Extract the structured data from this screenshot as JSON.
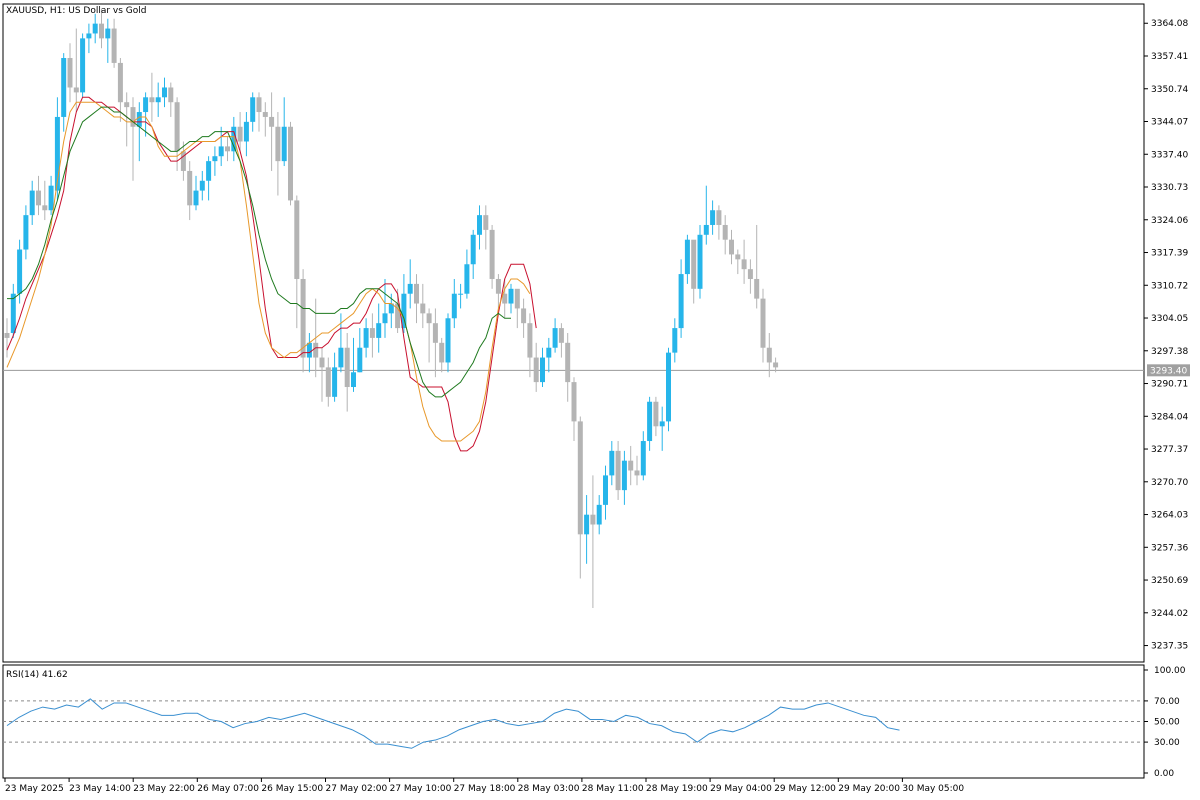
{
  "window": {
    "symbol_title": "XAUUSD, H1:  US Dollar vs Gold"
  },
  "colors": {
    "bull": "#26b5ea",
    "bear": "#b4b4b4",
    "ma_fast": "#c8102e",
    "ma_mid": "#e8982a",
    "ma_slow": "#1f7a1f",
    "rsi_line": "#3a8fd0",
    "current_price_line": "#9a9a9a",
    "price_tag_bg": "#a0a0a0"
  },
  "chart_data": [
    {
      "type": "candlestick",
      "title": "XAUUSD, H1:  US Dollar vs Gold",
      "ylim": [
        3234.0,
        3368.0
      ],
      "y_ticks": [
        "3364.08",
        "3357.41",
        "3350.74",
        "3344.07",
        "3337.40",
        "3330.73",
        "3324.06",
        "3317.39",
        "3310.72",
        "3304.05",
        "3297.38",
        "3290.71",
        "3284.04",
        "3277.37",
        "3270.70",
        "3264.03",
        "3257.36",
        "3250.69",
        "3244.02",
        "3237.35"
      ],
      "current_price": 3293.4,
      "current_price_label": "3293.40",
      "x_ticks": [
        "23 May 2025",
        "23 May 14:00",
        "23 May 22:00",
        "26 May 07:00",
        "26 May 15:00",
        "27 May 02:00",
        "27 May 10:00",
        "27 May 18:00",
        "28 May 03:00",
        "28 May 11:00",
        "28 May 19:00",
        "29 May 04:00",
        "29 May 12:00",
        "29 May 20:00",
        "30 May 05:00"
      ],
      "candles": [
        [
          3301,
          3300,
          3304,
          3296
        ],
        [
          3301,
          3309,
          3311,
          3300
        ],
        [
          3309,
          3318,
          3320,
          3307
        ],
        [
          3318,
          3325,
          3327,
          3316
        ],
        [
          3325,
          3330,
          3332,
          3323
        ],
        [
          3330,
          3327,
          3333,
          3325
        ],
        [
          3327,
          3326,
          3332,
          3324
        ],
        [
          3326,
          3331,
          3333,
          3325
        ],
        [
          3330,
          3345,
          3349,
          3328
        ],
        [
          3345,
          3357,
          3358,
          3342
        ],
        [
          3357,
          3351,
          3360,
          3348
        ],
        [
          3351,
          3350,
          3363,
          3346
        ],
        [
          3350,
          3361,
          3362,
          3349
        ],
        [
          3361,
          3362,
          3364,
          3358
        ],
        [
          3362,
          3364,
          3366,
          3360
        ],
        [
          3364,
          3361,
          3367,
          3359
        ],
        [
          3361,
          3363,
          3365,
          3356
        ],
        [
          3363,
          3356,
          3365,
          3355
        ],
        [
          3356,
          3348,
          3357,
          3344
        ],
        [
          3348,
          3347,
          3350,
          3339
        ],
        [
          3347,
          3343,
          3349,
          3332
        ],
        [
          3343,
          3346,
          3348,
          3336
        ],
        [
          3346,
          3349,
          3350,
          3341
        ],
        [
          3349,
          3348,
          3354,
          3344
        ],
        [
          3348,
          3349,
          3352,
          3345
        ],
        [
          3349,
          3351,
          3353,
          3347
        ],
        [
          3351,
          3348,
          3352,
          3345
        ],
        [
          3348,
          3338,
          3349,
          3334
        ],
        [
          3338,
          3334,
          3340,
          3332
        ],
        [
          3334,
          3327,
          3336,
          3324
        ],
        [
          3327,
          3330,
          3333,
          3326
        ],
        [
          3330,
          3332,
          3334,
          3328
        ],
        [
          3332,
          3336,
          3337,
          3328
        ],
        [
          3336,
          3337,
          3339,
          3333
        ],
        [
          3337,
          3339,
          3343,
          3335
        ],
        [
          3339,
          3338,
          3341,
          3336
        ],
        [
          3338,
          3343,
          3345,
          3336
        ],
        [
          3343,
          3340,
          3346,
          3338
        ],
        [
          3340,
          3344,
          3346,
          3337
        ],
        [
          3344,
          3349,
          3350,
          3342
        ],
        [
          3349,
          3346,
          3350,
          3342
        ],
        [
          3346,
          3345,
          3348,
          3341
        ],
        [
          3345,
          3343,
          3350,
          3334
        ],
        [
          3343,
          3336,
          3346,
          3329
        ],
        [
          3336,
          3343,
          3349,
          3335
        ],
        [
          3343,
          3328,
          3344,
          3327
        ],
        [
          3328,
          3312,
          3329,
          3302
        ],
        [
          3312,
          3296,
          3314,
          3293
        ],
        [
          3296,
          3299,
          3301,
          3293
        ],
        [
          3299,
          3296,
          3308,
          3292
        ],
        [
          3296,
          3294,
          3298,
          3287
        ],
        [
          3294,
          3288,
          3296,
          3286
        ],
        [
          3288,
          3294,
          3297,
          3287
        ],
        [
          3294,
          3298,
          3305,
          3293
        ],
        [
          3298,
          3290,
          3301,
          3285
        ],
        [
          3290,
          3293,
          3300,
          3289
        ],
        [
          3293,
          3298,
          3302,
          3293
        ],
        [
          3298,
          3302,
          3304,
          3296
        ],
        [
          3302,
          3300,
          3305,
          3296
        ],
        [
          3300,
          3303,
          3307,
          3297
        ],
        [
          3303,
          3305,
          3312,
          3300
        ],
        [
          3305,
          3307,
          3309,
          3302
        ],
        [
          3307,
          3302,
          3310,
          3301
        ],
        [
          3302,
          3309,
          3313,
          3301
        ],
        [
          3309,
          3311,
          3316,
          3306
        ],
        [
          3311,
          3307,
          3313,
          3303
        ],
        [
          3307,
          3305,
          3311,
          3302
        ],
        [
          3305,
          3303,
          3306,
          3295
        ],
        [
          3303,
          3299,
          3306,
          3292
        ],
        [
          3299,
          3295,
          3300,
          3293
        ],
        [
          3295,
          3304,
          3305,
          3293
        ],
        [
          3304,
          3309,
          3312,
          3302
        ],
        [
          3309,
          3309,
          3311,
          3306
        ],
        [
          3309,
          3315,
          3318,
          3308
        ],
        [
          3315,
          3321,
          3322,
          3312
        ],
        [
          3321,
          3325,
          3327,
          3318
        ],
        [
          3325,
          3322,
          3327,
          3318
        ],
        [
          3322,
          3312,
          3323,
          3310
        ],
        [
          3312,
          3309,
          3313,
          3306
        ],
        [
          3309,
          3307,
          3312,
          3304
        ],
        [
          3307,
          3310,
          3311,
          3305
        ],
        [
          3310,
          3306,
          3309,
          3302
        ],
        [
          3306,
          3303,
          3308,
          3300
        ],
        [
          3303,
          3296,
          3305,
          3292
        ],
        [
          3296,
          3291,
          3299,
          3289
        ],
        [
          3291,
          3296,
          3298,
          3290
        ],
        [
          3296,
          3298,
          3300,
          3293
        ],
        [
          3298,
          3302,
          3304,
          3297
        ],
        [
          3302,
          3299,
          3303,
          3296
        ],
        [
          3299,
          3291,
          3301,
          3287
        ],
        [
          3291,
          3283,
          3292,
          3279
        ],
        [
          3283,
          3260,
          3284,
          3251
        ],
        [
          3260,
          3264,
          3268,
          3254
        ],
        [
          3264,
          3262,
          3272,
          3245
        ],
        [
          3262,
          3266,
          3268,
          3260
        ],
        [
          3266,
          3272,
          3274,
          3263
        ],
        [
          3272,
          3277,
          3279,
          3270
        ],
        [
          3277,
          3269,
          3279,
          3267
        ],
        [
          3269,
          3275,
          3277,
          3266
        ],
        [
          3275,
          3273,
          3278,
          3270
        ],
        [
          3273,
          3272,
          3276,
          3270
        ],
        [
          3272,
          3279,
          3281,
          3271
        ],
        [
          3279,
          3287,
          3288,
          3277
        ],
        [
          3287,
          3282,
          3288,
          3280
        ],
        [
          3282,
          3283,
          3286,
          3277
        ],
        [
          3283,
          3297,
          3298,
          3281
        ],
        [
          3297,
          3302,
          3304,
          3295
        ],
        [
          3302,
          3313,
          3316,
          3300
        ],
        [
          3313,
          3320,
          3321,
          3311
        ],
        [
          3320,
          3310,
          3319,
          3307
        ],
        [
          3310,
          3321,
          3323,
          3308
        ],
        [
          3321,
          3323,
          3331,
          3319
        ],
        [
          3323,
          3326,
          3328,
          3321
        ],
        [
          3326,
          3323,
          3327,
          3320
        ],
        [
          3323,
          3320,
          3325,
          3317
        ],
        [
          3320,
          3317,
          3322,
          3315
        ],
        [
          3317,
          3316,
          3318,
          3313
        ],
        [
          3316,
          3314,
          3320,
          3311
        ],
        [
          3314,
          3312,
          3316,
          3309
        ],
        [
          3312,
          3308,
          3323,
          3306
        ],
        [
          3308,
          3298,
          3310,
          3295
        ],
        [
          3298,
          3295,
          3301,
          3292
        ],
        [
          3295,
          3294,
          3296,
          3293
        ]
      ],
      "series": [
        {
          "type": "line",
          "values": [
            3297.5,
            3300.5,
            3304,
            3308,
            3311,
            3314,
            3317,
            3321,
            3325,
            3330,
            3340,
            3346,
            3349,
            3349,
            3348,
            3348,
            3347,
            3347,
            3346,
            3345,
            3344,
            3344,
            3344,
            3343,
            3340,
            3338,
            3336,
            3336,
            3337,
            3338,
            3339,
            3340,
            3340,
            3340,
            3341,
            3342,
            3342,
            3338,
            3333,
            3325,
            3316,
            3306,
            3298,
            3296,
            3296,
            3296,
            3296,
            3297,
            3297,
            3298,
            3298,
            3299,
            3301,
            3302,
            3302,
            3303,
            3303,
            3305,
            3308,
            3310,
            3311,
            3311,
            3309,
            3300,
            3292,
            3291,
            3290,
            3290,
            3290,
            3290,
            3287,
            3280,
            3277,
            3277,
            3278,
            3281,
            3287,
            3296,
            3305,
            3312,
            3315,
            3315,
            3315,
            3311,
            3302
          ]
        },
        {
          "type": "line",
          "values": [
            3294,
            3297,
            3300,
            3304,
            3308,
            3312,
            3317,
            3323,
            3332,
            3340,
            3346,
            3348,
            3348,
            3348,
            3348,
            3347,
            3346,
            3345,
            3345,
            3344,
            3344,
            3345,
            3345,
            3343,
            3339,
            3337,
            3337,
            3337,
            3338,
            3339,
            3340,
            3340,
            3340,
            3340,
            3341,
            3341,
            3341,
            3336,
            3327,
            3317,
            3307,
            3301,
            3298,
            3297,
            3296,
            3297,
            3297,
            3298,
            3299,
            3300,
            3301,
            3301,
            3302,
            3303,
            3304,
            3305,
            3307,
            3309,
            3310,
            3309,
            3307,
            3307,
            3306,
            3304,
            3299,
            3292,
            3286,
            3282,
            3280,
            3279,
            3279,
            3279,
            3279,
            3280,
            3281,
            3283,
            3289,
            3298,
            3306,
            3310,
            3312,
            3312,
            3311,
            3309
          ]
        },
        {
          "type": "line",
          "values": [
            3308,
            3308,
            3309,
            3310,
            3312,
            3315,
            3319,
            3324,
            3328,
            3333,
            3338,
            3341,
            3344,
            3345,
            3346,
            3347,
            3347,
            3346,
            3346,
            3345,
            3344,
            3343,
            3342,
            3341,
            3340,
            3339,
            3338,
            3338,
            3339,
            3340,
            3340,
            3341,
            3341,
            3342,
            3342,
            3342,
            3339,
            3336,
            3332,
            3327,
            3321,
            3316,
            3312,
            3309,
            3308,
            3307,
            3307,
            3306,
            3306,
            3305,
            3305,
            3305,
            3305,
            3306,
            3306,
            3307,
            3309,
            3310,
            3310,
            3310,
            3309,
            3308,
            3307,
            3304,
            3299,
            3295,
            3291,
            3289,
            3288,
            3288,
            3289,
            3290,
            3291,
            3293,
            3295,
            3298,
            3300,
            3304,
            3305,
            3304,
            3304
          ]
        }
      ]
    },
    {
      "type": "line",
      "title": "RSI(14) 41.62",
      "ylim": [
        0,
        100
      ],
      "y_ticks": [
        "100.00",
        "70.00",
        "50.00",
        "30.00",
        "0.00"
      ],
      "levels": [
        70,
        50,
        30
      ],
      "x_ticks": [
        "23 May 2025",
        "23 May 14:00",
        "23 May 22:00",
        "26 May 07:00",
        "26 May 15:00",
        "27 May 02:00",
        "27 May 10:00",
        "27 May 18:00",
        "28 May 03:00",
        "28 May 11:00",
        "28 May 19:00",
        "29 May 04:00",
        "29 May 12:00",
        "29 May 20:00",
        "30 May 05:00"
      ],
      "series": [
        {
          "type": "line",
          "values": [
            46,
            54,
            60,
            64,
            62,
            66,
            64,
            72,
            62,
            68,
            68,
            64,
            60,
            56,
            56,
            58,
            58,
            52,
            50,
            44,
            48,
            50,
            54,
            52,
            55,
            58,
            54,
            50,
            46,
            42,
            36,
            28,
            28,
            26,
            24,
            30,
            32,
            36,
            42,
            46,
            50,
            52,
            48,
            46,
            48,
            50,
            58,
            62,
            60,
            52,
            52,
            50,
            56,
            54,
            48,
            46,
            40,
            38,
            30,
            38,
            42,
            40,
            44,
            50,
            56,
            64,
            62,
            62,
            66,
            68,
            64,
            60,
            56,
            54,
            44,
            41.62
          ]
        }
      ]
    }
  ]
}
